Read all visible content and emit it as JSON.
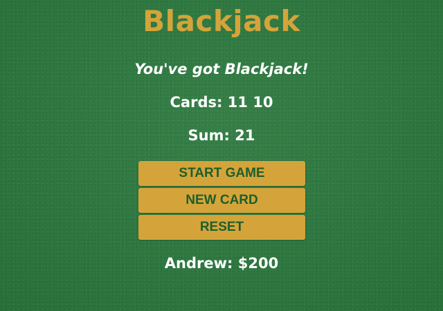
{
  "game": {
    "title": "Blackjack",
    "message": "You've got Blackjack!",
    "cards_label": "Cards:",
    "cards": [
      11,
      10
    ],
    "sum_label": "Sum:",
    "sum": 21
  },
  "buttons": {
    "start_label": "START GAME",
    "new_card_label": "NEW CARD",
    "reset_label": "RESET"
  },
  "player": {
    "name": "Andrew",
    "chips": "$200"
  },
  "colors": {
    "felt": "#2c7a3f",
    "gold": "#d4a43a",
    "button_text": "#1d5e2a",
    "text": "#ffffff"
  }
}
